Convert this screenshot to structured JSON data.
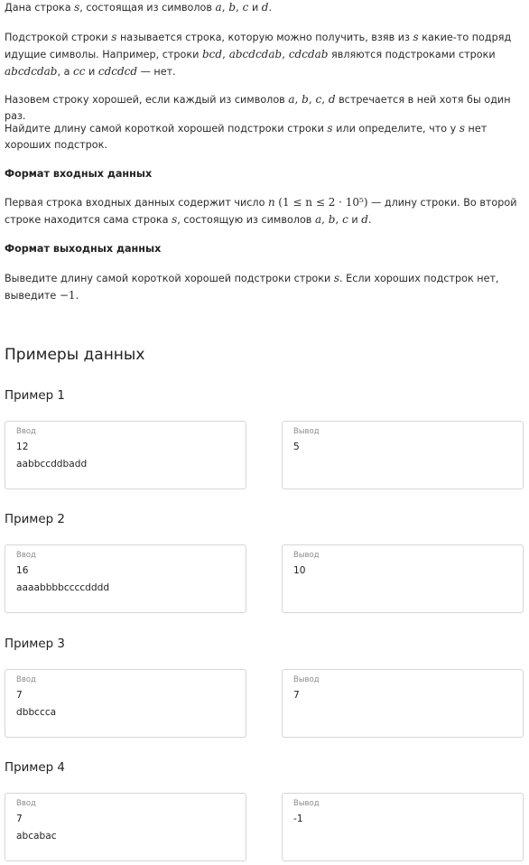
{
  "statement": {
    "p1": {
      "t1": "Дана строка ",
      "s": "s",
      "t2": ", состоящая из символов ",
      "a": "a",
      "c1": ", ",
      "b": "b",
      "c2": ", ",
      "c": "c",
      "t3": " и ",
      "d": "d",
      "t4": "."
    },
    "p2": {
      "t1": "Подстрокой строки ",
      "s1": "s",
      "t2": " называется строка, которую можно получить, взяв из ",
      "s2": "s",
      "t3": " какие-то подряд идущие символы. Например, строки ",
      "e1": "bcd",
      "c1": ", ",
      "e2": "abcdcdab",
      "c2": ", ",
      "e3": "cdcdab",
      "t4": " являются подстроками строки ",
      "e4": "abcdcdab",
      "t5": ", а ",
      "e5": "cc",
      "t6": " и ",
      "e6": "cdcdcd",
      "t7": " — нет."
    },
    "p3": {
      "t1": "Назовем строку хорошей, если каждый из символов ",
      "a": "a",
      "c1": ", ",
      "b": "b",
      "c2": ", ",
      "c": "c",
      "c3": ", ",
      "d": "d",
      "t2": " встречается в ней хотя бы один раз."
    },
    "p4": {
      "t1": "Найдите длину самой короткой хорошей подстроки строки ",
      "s1": "s",
      "t2": " или определите, что у ",
      "s2": "s",
      "t3": " нет хороших подстрок."
    },
    "input_heading": "Формат входных данных",
    "p5": {
      "t1": "Первая строка входных данных содержит число ",
      "n": "n",
      "bounds": "(1 ≤ n ≤ 2 · 10⁵)",
      "t2": " — длину строки. Во второй строке находится сама строка ",
      "s": "s",
      "t3": ", состоящую из символов ",
      "a": "a",
      "c1": ", ",
      "b": "b",
      "c2": ", ",
      "c": "c",
      "t4": " и ",
      "d": "d",
      "t5": "."
    },
    "output_heading": "Формат выходных данных",
    "p6": {
      "t1": "Выведите длину самой короткой хорошей подстроки строки ",
      "s": "s",
      "t2": ". Если хороших подстрок нет, выведите ",
      "neg": "−1",
      "t3": "."
    }
  },
  "examples_heading": "Примеры данных",
  "examples": [
    {
      "title": "Пример 1",
      "input_label": "Ввод",
      "input_lines": [
        "12",
        "aabbccddbadd"
      ],
      "output_label": "Вывод",
      "output": "5"
    },
    {
      "title": "Пример 2",
      "input_label": "Ввод",
      "input_lines": [
        "16",
        "aaaabbbbccccdddd"
      ],
      "output_label": "Вывод",
      "output": "10"
    },
    {
      "title": "Пример 3",
      "input_label": "Ввод",
      "input_lines": [
        "7",
        "dbbccca"
      ],
      "output_label": "Вывод",
      "output": "7"
    },
    {
      "title": "Пример 4",
      "input_label": "Ввод",
      "input_lines": [
        "7",
        "abcabac"
      ],
      "output_label": "Вывод",
      "output": "-1"
    }
  ]
}
